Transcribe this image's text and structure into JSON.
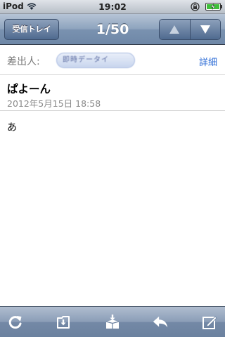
{
  "status_bar": {
    "carrier": "iPod",
    "time": "19:02",
    "icons": [
      "wifi-icon",
      "rotation-lock-icon",
      "battery-charging-icon"
    ]
  },
  "nav": {
    "back_label": "受信トレイ",
    "title": "1/50",
    "prev_icon": "up-arrow-icon",
    "next_icon": "down-arrow-icon"
  },
  "message": {
    "from_label": "差出人:",
    "sender": "即時データイ",
    "details_label": "詳細",
    "subject": "ぱよーん",
    "date": "2012年5月15日 18:58",
    "body": "あ"
  },
  "toolbar": {
    "icons": [
      "refresh-icon",
      "move-to-folder-icon",
      "archive-icon",
      "reply-icon",
      "compose-icon"
    ]
  },
  "colors": {
    "link": "#2b6bd6",
    "bar": "#7a92b0"
  }
}
